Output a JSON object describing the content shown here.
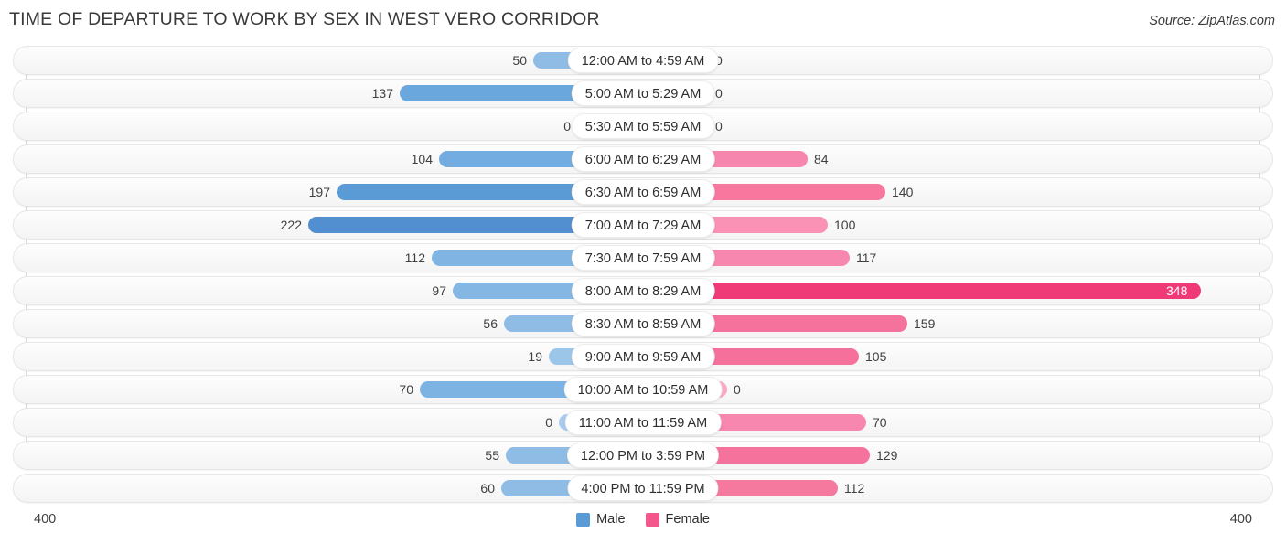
{
  "header": {
    "title": "TIME OF DEPARTURE TO WORK BY SEX IN WEST VERO CORRIDOR",
    "source": "Source: ZipAtlas.com"
  },
  "axis": {
    "left_max_label": "400",
    "right_max_label": "400"
  },
  "legend": [
    {
      "label": "Male",
      "color": "#5b9bd5"
    },
    {
      "label": "Female",
      "color": "#f2588c"
    }
  ],
  "colors": {
    "male_base": "#5b9bd5",
    "female_base": "#f2588c",
    "male_light": "#a8cbee",
    "female_light": "#f9a8c4",
    "track": "#f6f6f6",
    "grid": "#d9d9d9",
    "text": "#404040"
  },
  "chart_data": {
    "type": "bar",
    "orientation": "horizontal-diverging",
    "title": "TIME OF DEPARTURE TO WORK BY SEX IN WEST VERO CORRIDOR",
    "xlabel": "",
    "ylabel": "",
    "xlim": [
      400,
      400
    ],
    "grid": true,
    "legend_position": "bottom-center",
    "categories": [
      "12:00 AM to 4:59 AM",
      "5:00 AM to 5:29 AM",
      "5:30 AM to 5:59 AM",
      "6:00 AM to 6:29 AM",
      "6:30 AM to 6:59 AM",
      "7:00 AM to 7:29 AM",
      "7:30 AM to 7:59 AM",
      "8:00 AM to 8:29 AM",
      "8:30 AM to 8:59 AM",
      "9:00 AM to 9:59 AM",
      "10:00 AM to 10:59 AM",
      "11:00 AM to 11:59 AM",
      "12:00 PM to 3:59 PM",
      "4:00 PM to 11:59 PM"
    ],
    "series": [
      {
        "name": "Male",
        "values": [
          50,
          137,
          0,
          104,
          197,
          222,
          112,
          97,
          56,
          19,
          70,
          0,
          55,
          60
        ]
      },
      {
        "name": "Female",
        "values": [
          0,
          0,
          0,
          84,
          140,
          100,
          117,
          348,
          159,
          105,
          0,
          70,
          129,
          112
        ]
      }
    ]
  },
  "rows": [
    {
      "category": "12:00 AM to 4:59 AM",
      "male": 50,
      "female": 0,
      "male_label": "50",
      "female_label": "0",
      "male_color": "#8fbce5",
      "female_color": "#f9a8c4",
      "male_w": 120,
      "female_w": 72,
      "female_inside": false
    },
    {
      "category": "5:00 AM to 5:29 AM",
      "male": 137,
      "female": 0,
      "male_label": "137",
      "female_label": "0",
      "male_color": "#6aa7dc",
      "female_color": "#f9a8c4",
      "male_w": 266,
      "female_w": 72,
      "female_inside": false
    },
    {
      "category": "5:30 AM to 5:59 AM",
      "male": 0,
      "female": 0,
      "male_label": "0",
      "female_label": "0",
      "male_color": "#a8cbee",
      "female_color": "#f9a8c4",
      "male_w": 72,
      "female_w": 72,
      "female_inside": false
    },
    {
      "category": "6:00 AM to 6:29 AM",
      "male": 104,
      "female": 84,
      "male_label": "104",
      "female_label": "84",
      "male_color": "#73ace0",
      "female_color": "#f786ae",
      "male_w": 223,
      "female_w": 180,
      "female_inside": false
    },
    {
      "category": "6:30 AM to 6:59 AM",
      "male": 197,
      "female": 140,
      "male_label": "197",
      "female_label": "140",
      "male_color": "#5b9bd5",
      "female_color": "#f7779f",
      "male_w": 335,
      "female_w": 265,
      "female_inside": false
    },
    {
      "category": "7:00 AM to 7:29 AM",
      "male": 222,
      "female": 100,
      "male_label": "222",
      "female_label": "100",
      "male_color": "#528fd0",
      "female_color": "#f992b4",
      "male_w": 366,
      "female_w": 202,
      "female_inside": false
    },
    {
      "category": "7:30 AM to 7:59 AM",
      "male": 112,
      "female": 117,
      "male_label": "112",
      "female_label": "117",
      "male_color": "#80b5e3",
      "female_color": "#f787ae",
      "male_w": 231,
      "female_w": 226,
      "female_inside": false
    },
    {
      "category": "8:00 AM to 8:29 AM",
      "male": 97,
      "female": 348,
      "male_label": "97",
      "female_label": "348",
      "male_color": "#84b7e4",
      "female_color": "#f03a78",
      "male_w": 208,
      "female_w": 610,
      "female_inside": true
    },
    {
      "category": "8:30 AM to 8:59 AM",
      "male": 56,
      "female": 159,
      "male_label": "56",
      "female_label": "159",
      "male_color": "#8fbce5",
      "female_color": "#f5729d",
      "male_w": 152,
      "female_w": 289,
      "female_inside": false
    },
    {
      "category": "9:00 AM to 9:59 AM",
      "male": 19,
      "female": 105,
      "male_label": "19",
      "female_label": "105",
      "male_color": "#9cc5ea",
      "female_color": "#f5719c",
      "male_w": 103,
      "female_w": 236,
      "female_inside": false
    },
    {
      "category": "10:00 AM to 10:59 AM",
      "male": 70,
      "female": 0,
      "male_label": "70",
      "female_label": "0",
      "male_color": "#7db3e2",
      "female_color": "#f9a8c4",
      "male_w": 244,
      "female_w": 92,
      "female_inside": false
    },
    {
      "category": "11:00 AM to 11:59 AM",
      "male": 0,
      "female": 70,
      "male_label": "0",
      "female_label": "70",
      "male_color": "#a8cbee",
      "female_color": "#f787ae",
      "male_w": 92,
      "female_w": 244,
      "female_inside": false
    },
    {
      "category": "12:00 PM to 3:59 PM",
      "male": 55,
      "female": 129,
      "male_label": "55",
      "female_label": "129",
      "male_color": "#8fbce5",
      "female_color": "#f5729d",
      "male_w": 150,
      "female_w": 248,
      "female_inside": false
    },
    {
      "category": "4:00 PM to 11:59 PM",
      "male": 60,
      "female": 112,
      "male_label": "60",
      "female_label": "112",
      "male_color": "#8fbce5",
      "female_color": "#f5799f",
      "male_w": 155,
      "female_w": 213,
      "female_inside": false
    }
  ]
}
